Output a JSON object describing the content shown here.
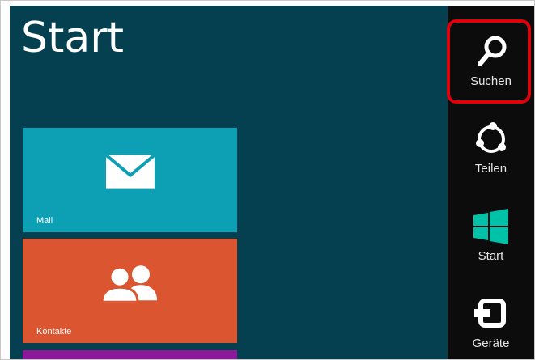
{
  "start_screen": {
    "title": "Start",
    "tiles": [
      {
        "label": "Mail",
        "icon": "mail-icon",
        "color": "#0da0b5"
      },
      {
        "label": "Kontakte",
        "icon": "contacts-icon",
        "color": "#db5530"
      },
      {
        "label": "",
        "icon": "",
        "color": "#8a1a9a"
      }
    ]
  },
  "charms": [
    {
      "label": "Suchen",
      "icon": "search-icon",
      "highlighted": true
    },
    {
      "label": "Teilen",
      "icon": "share-icon",
      "highlighted": false
    },
    {
      "label": "Start",
      "icon": "windows-logo-icon",
      "highlighted": false
    },
    {
      "label": "Geräte",
      "icon": "devices-icon",
      "highlighted": false
    }
  ],
  "colors": {
    "start_background": "#04404f",
    "charms_background": "#0c0c0c",
    "highlight": "#e0000a"
  }
}
